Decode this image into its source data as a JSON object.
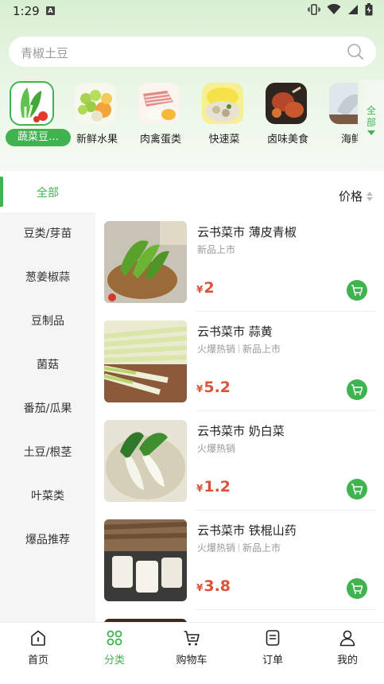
{
  "status_bar": {
    "time": "1:29",
    "a_badge": "A"
  },
  "search": {
    "placeholder": "青椒土豆"
  },
  "categories": [
    {
      "label": "蔬菜豆…",
      "icon": "vegetable-bok-choy-icon",
      "active": true
    },
    {
      "label": "新鲜水果",
      "icon": "fruit-grapes-icon",
      "active": false
    },
    {
      "label": "肉禽蛋类",
      "icon": "meat-egg-icon",
      "active": false
    },
    {
      "label": "快速菜",
      "icon": "quick-dish-icon",
      "active": false
    },
    {
      "label": "卤味美食",
      "icon": "braised-food-icon",
      "active": false
    },
    {
      "label": "海鲜",
      "icon": "seafood-icon",
      "active": false
    }
  ],
  "all_categories_label": "全部",
  "filter": {
    "all_label": "全部",
    "price_label": "价格"
  },
  "sidebar": {
    "items": [
      "豆类/芽苗",
      "葱姜椒蒜",
      "豆制品",
      "菌菇",
      "番茄/瓜果",
      "土豆/根茎",
      "叶菜类",
      "爆品推荐"
    ]
  },
  "products": [
    {
      "name": "云书菜市 薄皮青椒",
      "tags": [
        "新品上市"
      ],
      "currency": "¥",
      "price": "2"
    },
    {
      "name": "云书菜市 蒜黄",
      "tags": [
        "火爆热销",
        "新品上市"
      ],
      "currency": "¥",
      "price": "5.2"
    },
    {
      "name": "云书菜市 奶白菜",
      "tags": [
        "火爆热销"
      ],
      "currency": "¥",
      "price": "1.2"
    },
    {
      "name": "云书菜市 铁棍山药",
      "tags": [
        "火爆热销",
        "新品上市"
      ],
      "currency": "¥",
      "price": "3.8"
    }
  ],
  "bottom_nav": [
    {
      "label": "首页",
      "icon": "home-icon",
      "active": false
    },
    {
      "label": "分类",
      "icon": "category-icon",
      "active": true
    },
    {
      "label": "购物车",
      "icon": "cart-icon",
      "active": false
    },
    {
      "label": "订单",
      "icon": "order-icon",
      "active": false
    },
    {
      "label": "我的",
      "icon": "profile-icon",
      "active": false
    }
  ],
  "colors": {
    "accent": "#3fb34f",
    "price": "#d9533a",
    "sidebar_bg": "#f5f5f5"
  }
}
